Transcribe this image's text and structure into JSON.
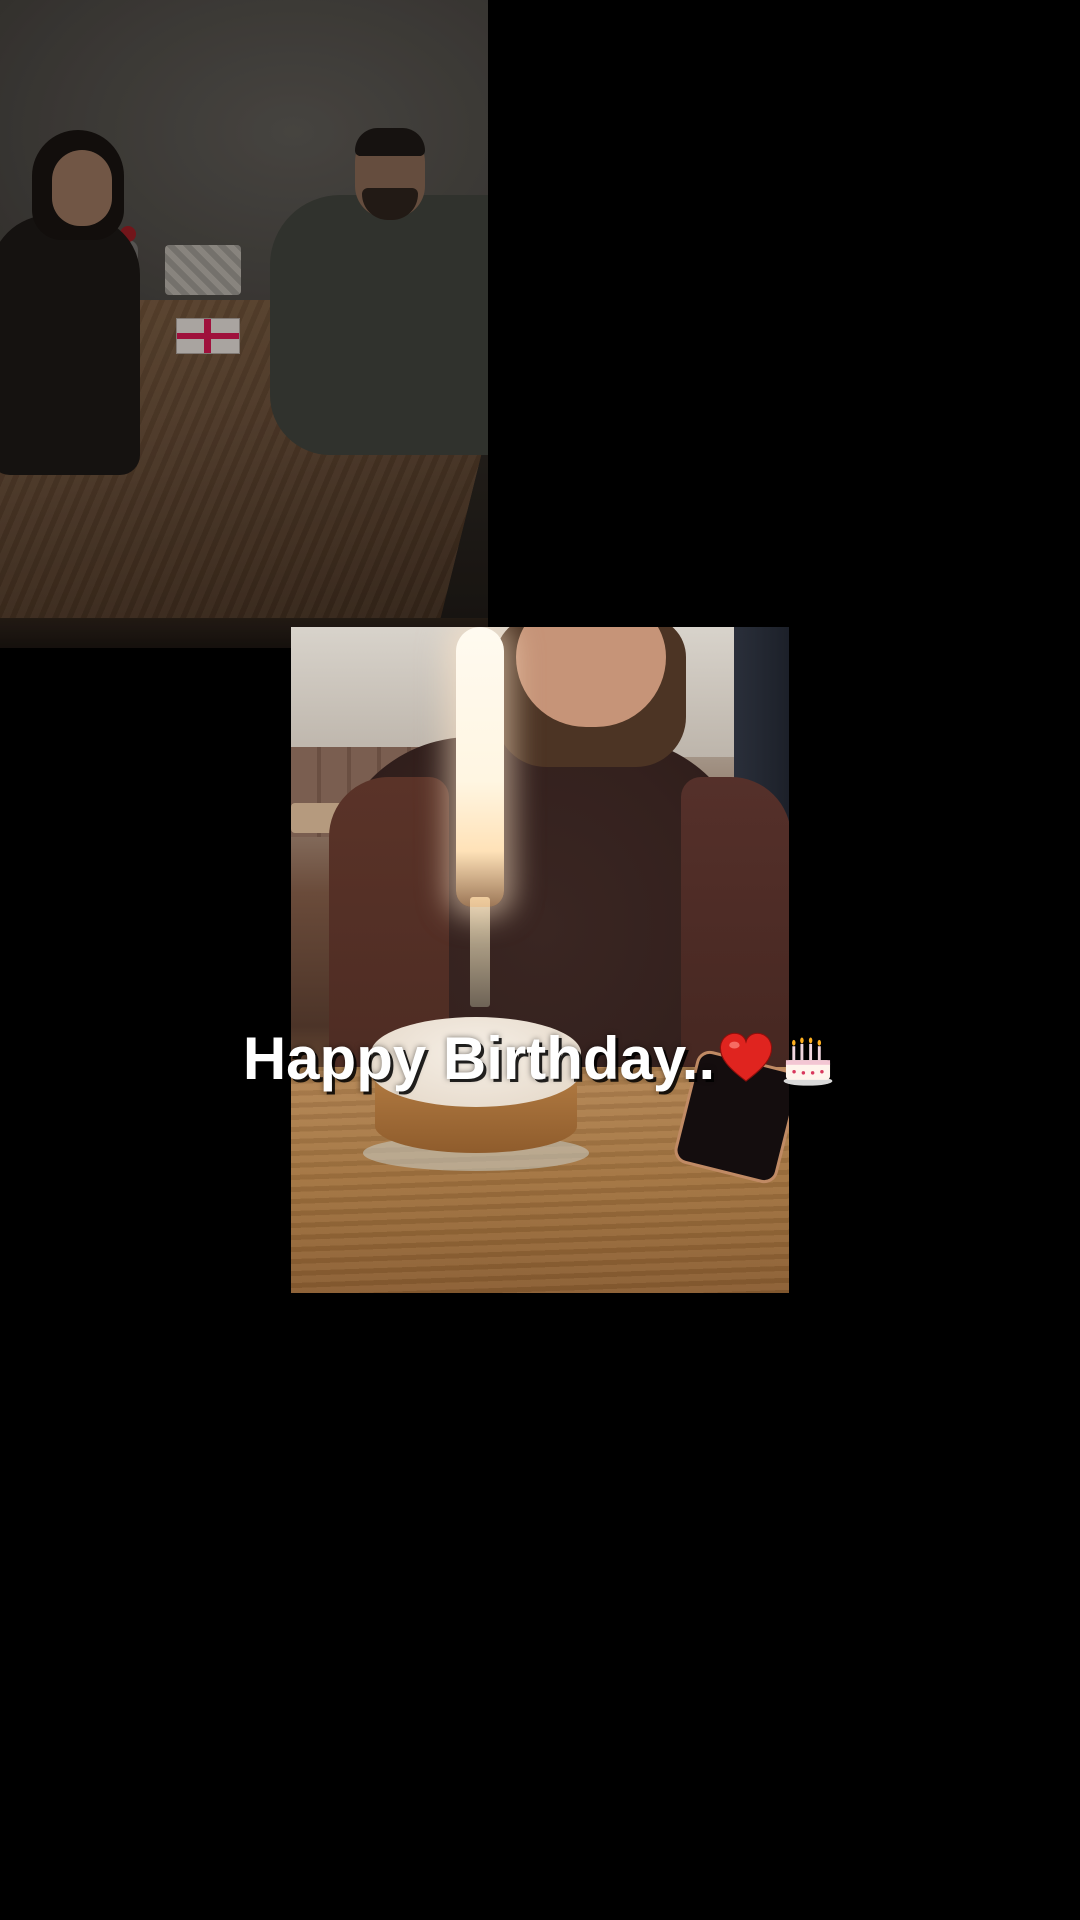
{
  "story": {
    "caption": "Happy Birthday..",
    "caption_emojis": [
      "heart-icon",
      "birthday-cake-icon"
    ],
    "colors": {
      "background": "#000000",
      "caption_text": "#ffffff",
      "heart": "#e0241f"
    }
  }
}
